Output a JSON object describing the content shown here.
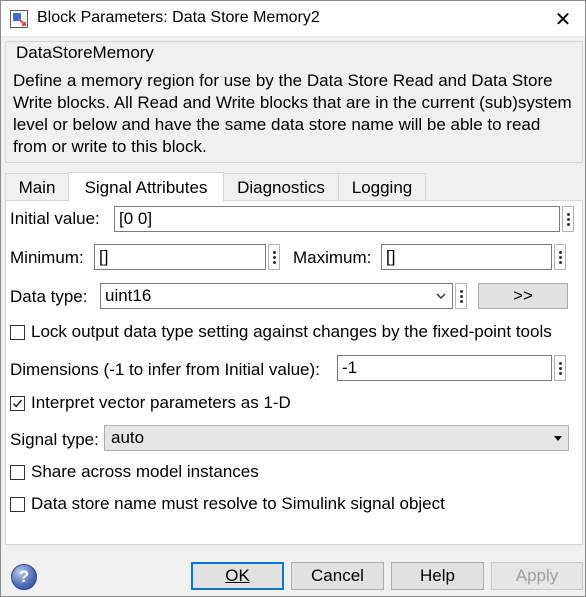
{
  "window": {
    "title": "Block Parameters: Data Store Memory2",
    "close_glyph": "✕"
  },
  "block": {
    "type_name": "DataStoreMemory",
    "description": "Define a memory region for use by the Data Store Read and Data Store Write blocks. All Read and Write blocks that are in the current (sub)system level or below and have the same data store name will be able to read from or write to this block."
  },
  "tabs": [
    {
      "label": "Main",
      "active": false
    },
    {
      "label": "Signal Attributes",
      "active": true
    },
    {
      "label": "Diagnostics",
      "active": false
    },
    {
      "label": "Logging",
      "active": false
    }
  ],
  "signal_attributes": {
    "initial_value_label": "Initial value:",
    "initial_value": "[0 0]",
    "minimum_label": "Minimum:",
    "minimum": "[]",
    "maximum_label": "Maximum:",
    "maximum": "[]",
    "data_type_label": "Data type:",
    "data_type": "uint16",
    "data_type_assistant_label": ">>",
    "lock_output_label": "Lock output data type setting against changes by the fixed-point tools",
    "lock_output_checked": false,
    "dimensions_label": "Dimensions (-1 to infer from Initial value):",
    "dimensions": "-1",
    "interpret_vector_label": "Interpret vector parameters as 1-D",
    "interpret_vector_checked": true,
    "signal_type_label": "Signal type:",
    "signal_type": "auto",
    "share_label": "Share across model instances",
    "share_checked": false,
    "resolve_label": "Data store name must resolve to Simulink signal object",
    "resolve_checked": false
  },
  "footer": {
    "ok": "OK",
    "cancel": "Cancel",
    "help": "Help",
    "apply": "Apply"
  },
  "colors": {
    "accent": "#0078d7",
    "panel_bg": "#ffffff",
    "window_bg": "#f0f0f0"
  }
}
